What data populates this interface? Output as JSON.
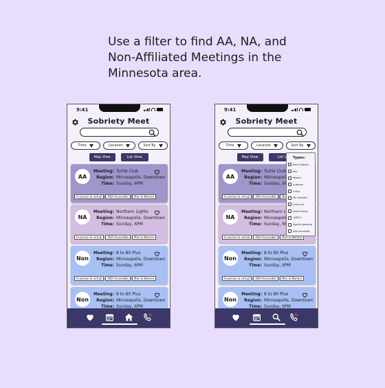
{
  "headline": "Use a filter to find AA, NA, and Non-Affiliated Meetings in the Minnesota area.",
  "phone": {
    "time": "9:41",
    "app_title": "Sobriety Meet",
    "filters": [
      "Time",
      "Location",
      "Sort By"
    ],
    "map_view": "Map View",
    "list_view": "List View",
    "list_view_clipped": "List V",
    "labels": {
      "meeting": "Meeting:",
      "region": "Region:",
      "time": "Time:"
    }
  },
  "cards": [
    {
      "avatar": "AA",
      "meeting": "Turtle Club",
      "region": "Minneapolis, Downtown",
      "time": "Sunday, 6PM",
      "color": "#a096cc",
      "tags": [
        "In-person & virtual",
        "ADA Accessible",
        "Men & Women"
      ]
    },
    {
      "avatar": "NA",
      "meeting": "Northern Lights",
      "region": "Minneapolis, Downtown",
      "time": "Sunday, 6PM",
      "color": "#d3bde0",
      "tags": [
        "In-person & virtual",
        "ADA Accessible",
        "Men & Women"
      ]
    },
    {
      "avatar": "Non",
      "meeting": "8 to 80 Plus",
      "region": "Minneapolis, Downtown",
      "time": "Sunday, 6PM",
      "color": "#a9c0f4",
      "tags": [
        "In-person & virtual",
        "ADA Accessible",
        "Men & Women"
      ]
    },
    {
      "avatar": "Non",
      "meeting": "8 to 80 Plus",
      "region": "Minneapolis, Downtown",
      "time": "Sunday, 6PM",
      "color": "#a9c0f4",
      "tags": []
    }
  ],
  "cards_right_clipped": [
    {
      "meeting": "Turtle Club",
      "region": "Minneapolis",
      "time": "Sunday, 6PM"
    },
    {
      "meeting": "Northern Lig",
      "region": "Minneapolis",
      "time": "Sunday, 6PM"
    }
  ],
  "dropdown": {
    "title": "Types:",
    "items": [
      "Men & Women",
      "Men",
      "Women",
      "In-person",
      "Online",
      "ASL Provided",
      "Child Care",
      "Child Friendly",
      "LGBTQ+",
      "Spanish speaking",
      "ADA Accessible"
    ]
  },
  "nav": [
    "heart-icon",
    "calendar-icon",
    "home-icon",
    "phone-icon"
  ],
  "nav_right": [
    "heart-icon",
    "calendar-icon",
    "search-icon",
    "phone-icon"
  ],
  "colors": {
    "background": "#e9ddfd",
    "nav": "#3b3768",
    "accent": "#e5484d"
  }
}
